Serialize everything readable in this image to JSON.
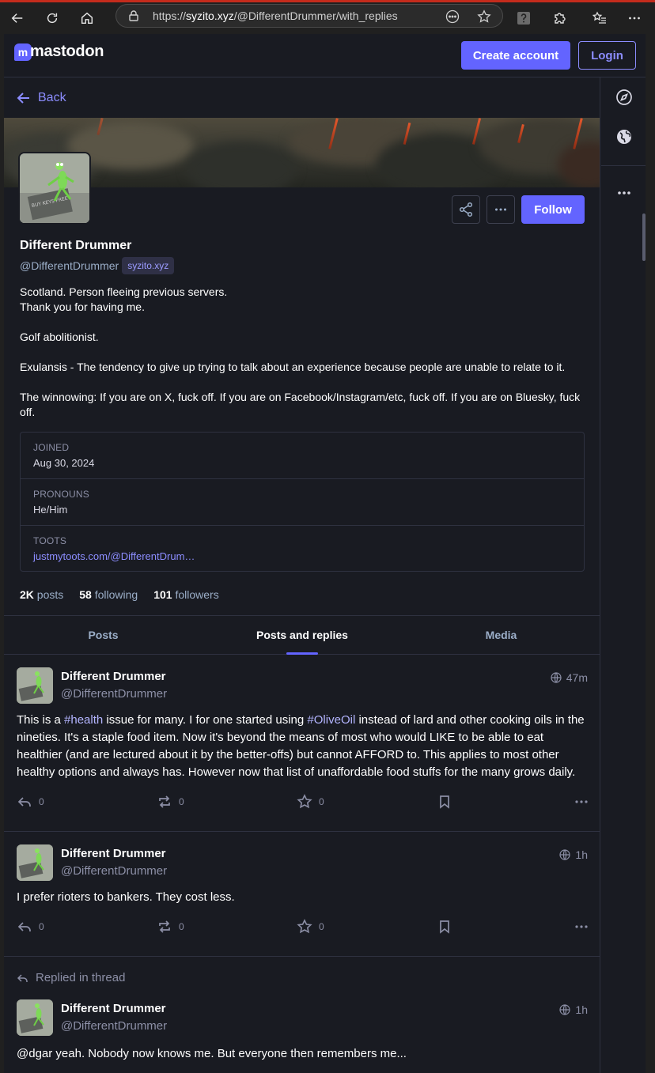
{
  "browser": {
    "url_prefix": "https://",
    "url_host": "syzito.xyz",
    "url_path": "/@DifferentDrummer/with_replies"
  },
  "header": {
    "logo_text": "mastodon",
    "create_account_label": "Create account",
    "login_label": "Login"
  },
  "nav": {
    "back_label": "Back"
  },
  "profile": {
    "display_name": "Different Drummer",
    "handle": "@DifferentDrummer",
    "domain": "syzito.xyz",
    "follow_label": "Follow",
    "bio": [
      "Scotland. Person fleeing previous servers.",
      "Thank you for having me.",
      "Golf abolitionist.",
      "Exulansis - The tendency to give up trying to talk about an experience because people are unable to relate to it.",
      "The winnowing: If you are on X, fuck off. If you are on Facebook/Instagram/etc, fuck off. If you are on Bluesky, fuck off."
    ],
    "fields": [
      {
        "name": "JOINED",
        "value": "Aug 30, 2024"
      },
      {
        "name": "PRONOUNS",
        "value": "He/Him"
      },
      {
        "name": "TOOTS",
        "value": "justmytoots.com/@DifferentDrum…"
      }
    ],
    "stats": {
      "posts_count": "2K",
      "posts_label": "posts",
      "following_count": "58",
      "following_label": "following",
      "followers_count": "101",
      "followers_label": "followers"
    }
  },
  "tabs": [
    {
      "label": "Posts"
    },
    {
      "label": "Posts and replies"
    },
    {
      "label": "Media"
    }
  ],
  "posts": [
    {
      "name": "Different Drummer",
      "handle": "@DifferentDrummer",
      "time": "47m",
      "content_parts": [
        "This is a ",
        "#health",
        " issue for many. I for one started using ",
        "#OliveOil",
        " instead of lard and other cooking oils in the nineties.  It's a staple food item.  Now it's beyond the means of most who would LIKE to be able to eat healthier (and are lectured about it by the better-offs) but cannot AFFORD to.  This applies to most other healthy options and always has.  However now that list of unaffordable food stuffs for the many grows daily."
      ],
      "replies": "0",
      "boosts": "0",
      "favourites": "0"
    },
    {
      "name": "Different Drummer",
      "handle": "@DifferentDrummer",
      "time": "1h",
      "content": "I prefer rioters to bankers. They cost less.",
      "replies": "0",
      "boosts": "0",
      "favourites": "0"
    },
    {
      "prepend": "Replied in thread",
      "name": "Different Drummer",
      "handle": "@DifferentDrummer",
      "time": "1h",
      "content": "@dgar yeah.  Nobody now knows me. But everyone then remembers me..."
    }
  ],
  "avatar_badge_text": "BUY KEYS FREE"
}
